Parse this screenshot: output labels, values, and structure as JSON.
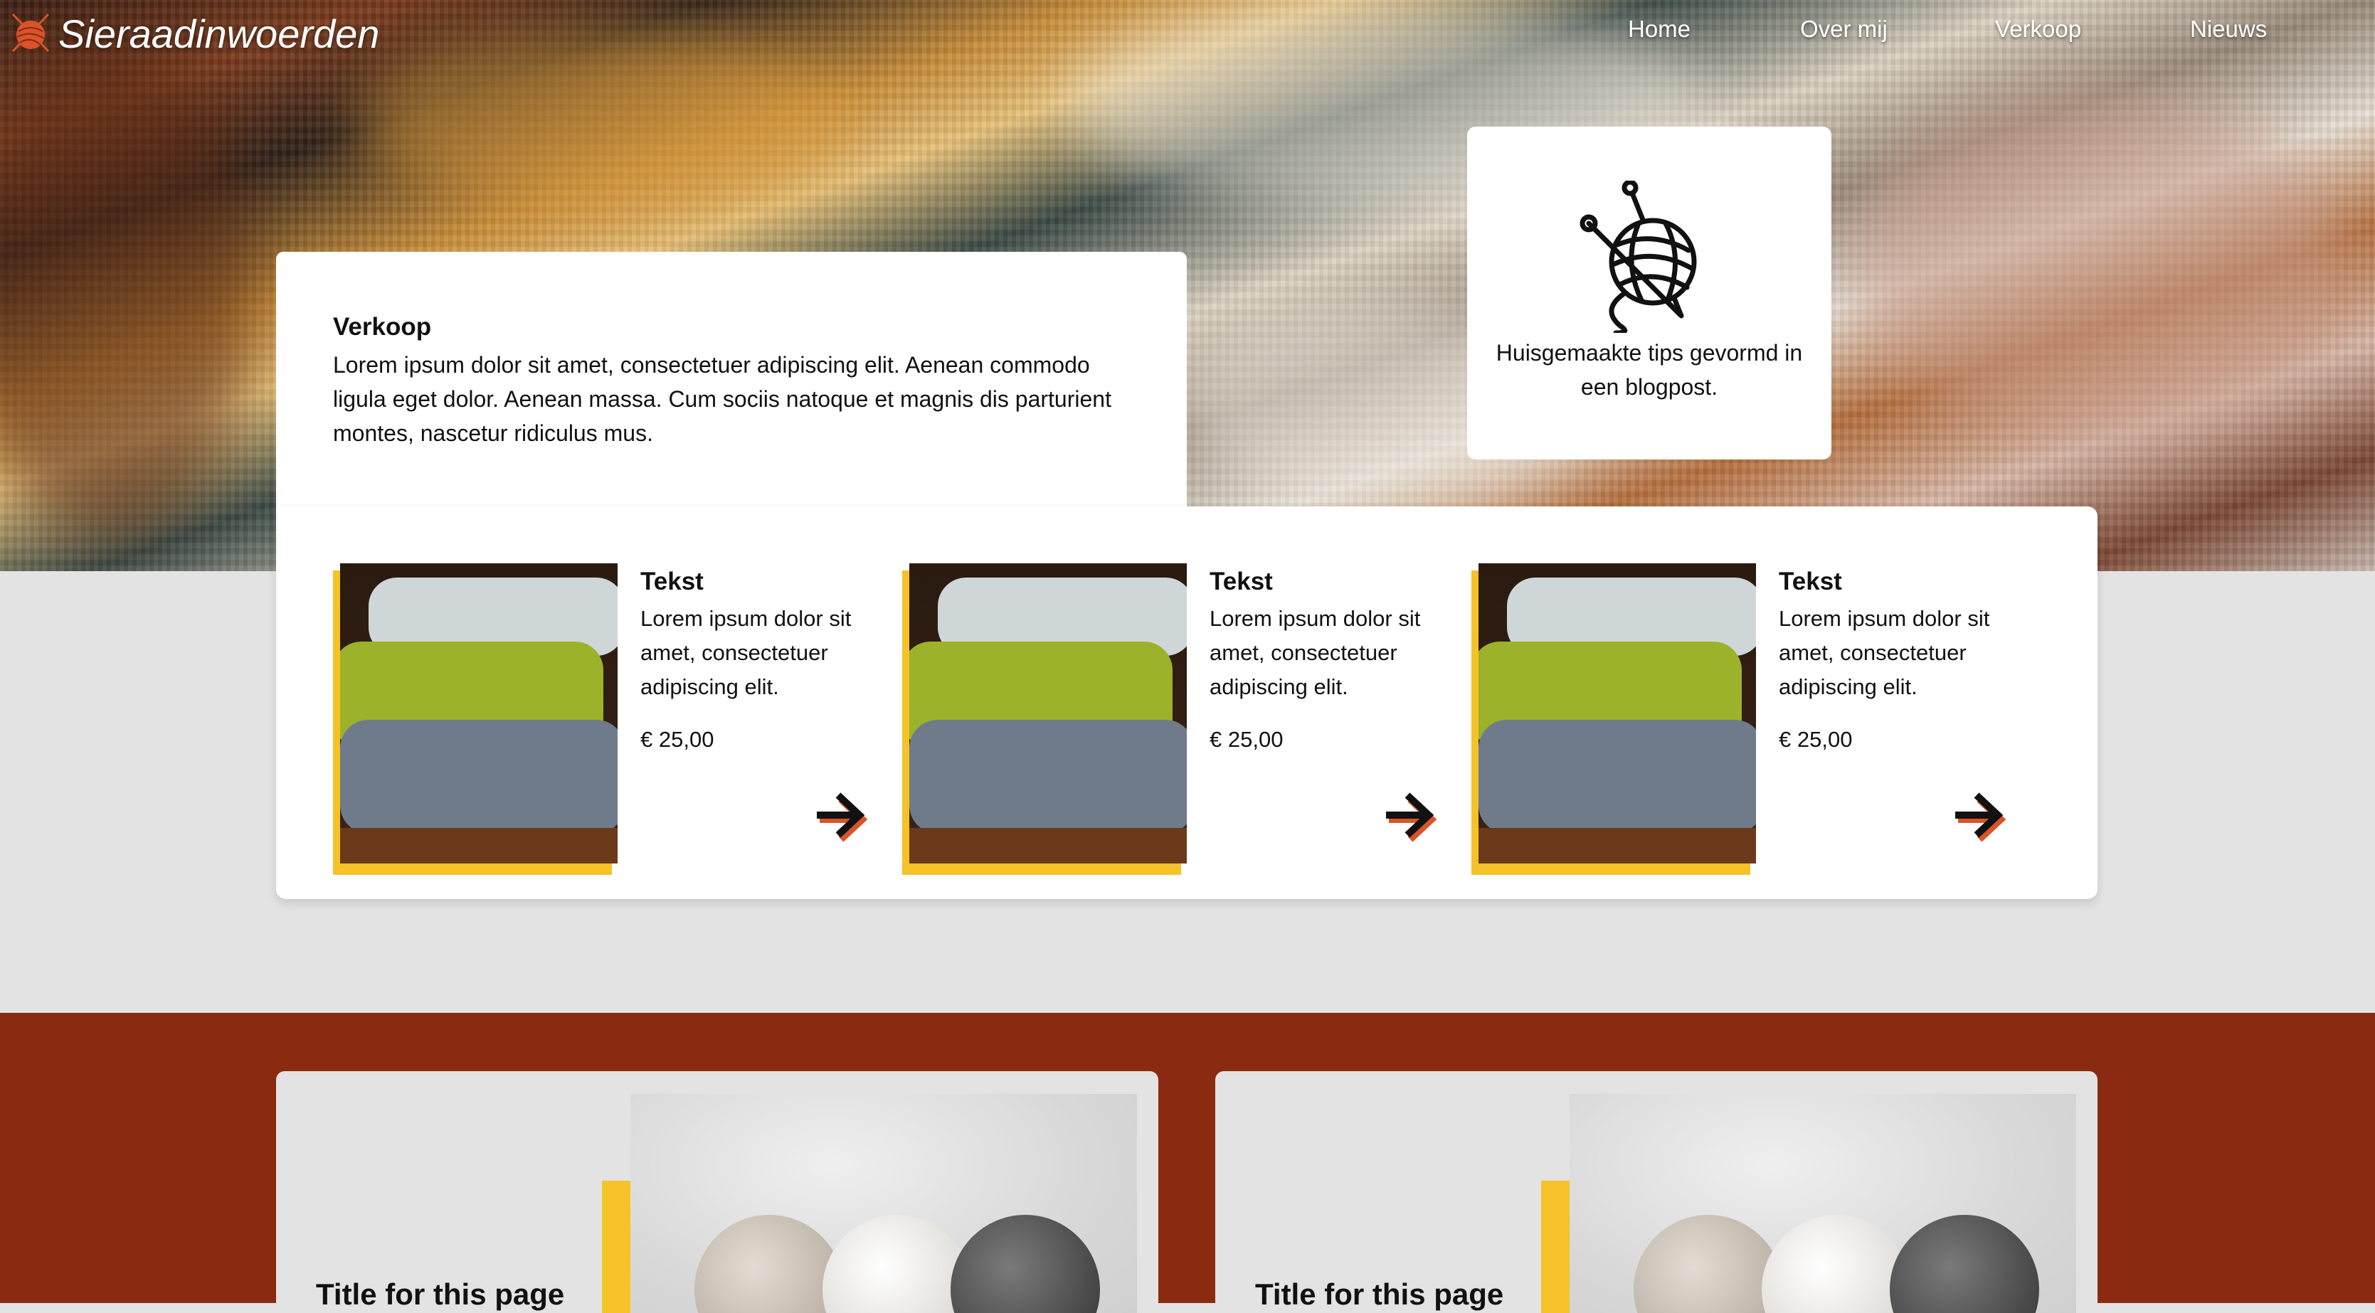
{
  "header": {
    "logo_text": "Sieraadinwoerden",
    "nav": [
      {
        "label": "Home"
      },
      {
        "label": "Over mij"
      },
      {
        "label": "Verkoop"
      },
      {
        "label": "Nieuws"
      }
    ]
  },
  "intro": {
    "title": "Verkoop",
    "body": "Lorem ipsum dolor sit amet, consectetuer adipiscing elit. Aenean commodo ligula eget dolor. Aenean massa. Cum sociis natoque et magnis dis parturient montes, nascetur ridiculus mus."
  },
  "tip": {
    "icon": "yarn-ball-needles-icon",
    "text": "Huisgemaakte tips gevormd in een blogpost."
  },
  "products": [
    {
      "title": "Tekst",
      "description": "Lorem ipsum dolor sit amet, consectetuer adipiscing elit.",
      "price": "€ 25,00",
      "icon": "arrow-right-icon"
    },
    {
      "title": "Tekst",
      "description": "Lorem ipsum dolor sit amet, consectetuer adipiscing elit.",
      "price": "€ 25,00",
      "icon": "arrow-right-icon"
    },
    {
      "title": "Tekst",
      "description": "Lorem ipsum dolor sit amet, consectetuer adipiscing elit.",
      "price": "€ 25,00",
      "icon": "arrow-right-icon"
    }
  ],
  "blog": {
    "cards": [
      {
        "title": "Title for this page"
      },
      {
        "title": "Title for this page"
      }
    ]
  },
  "colors": {
    "accent_yellow": "#f5c227",
    "blog_background": "#8a2a10",
    "page_background": "#e3e3e3",
    "card_background": "#ffffff",
    "logo_orange": "#d9542a"
  }
}
